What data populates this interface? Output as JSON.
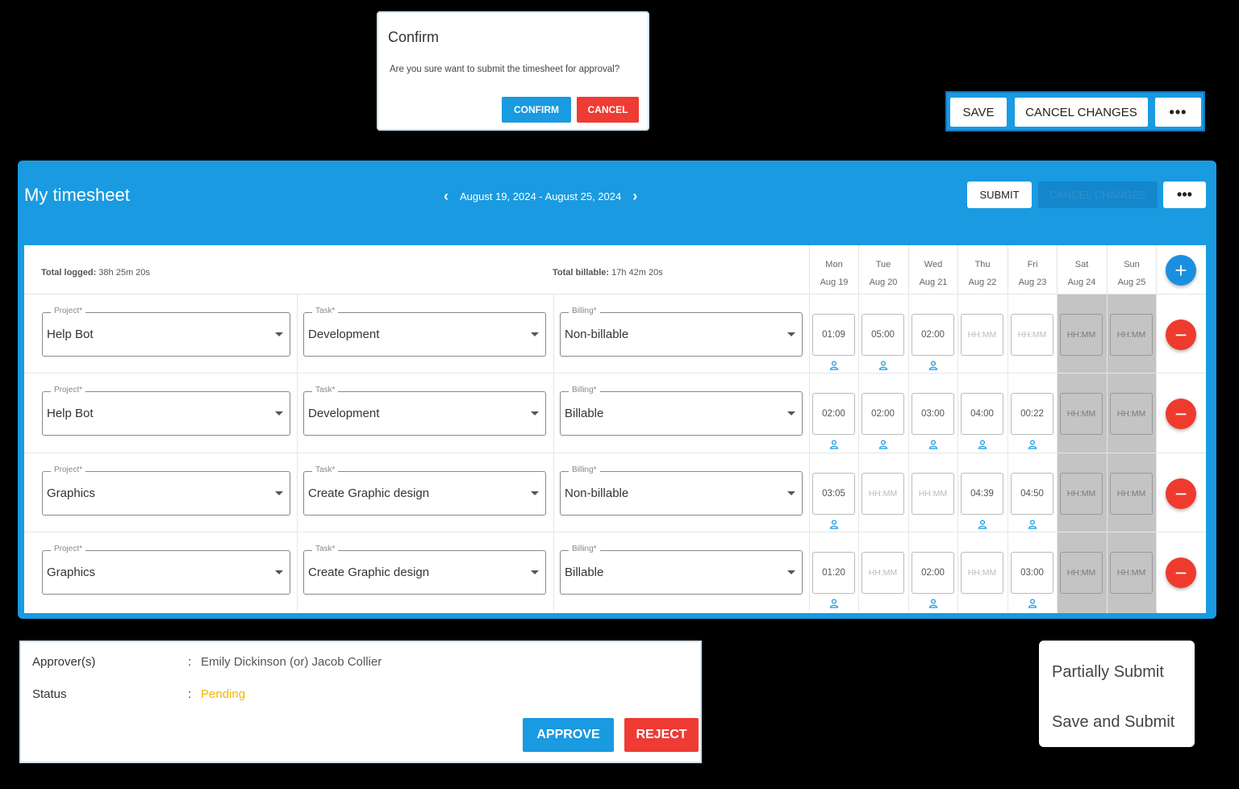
{
  "confirm": {
    "title": "Confirm",
    "message": "Are you sure want to submit the timesheet for approval?",
    "confirm_label": "CONFIRM",
    "cancel_label": "CANCEL"
  },
  "toolbar": {
    "save_label": "SAVE",
    "cancel_changes_label": "CANCEL CHANGES",
    "more_label": "•••"
  },
  "timesheet": {
    "title": "My timesheet",
    "prev_icon": "‹",
    "next_icon": "›",
    "date_range": "August 19, 2024 - August 25, 2024",
    "submit_label": "SUBMIT",
    "cancel_changes_label": "CANCEL CHANGES",
    "more_label": "•••",
    "total_logged_label": "Total logged:",
    "total_logged": "38h 25m 20s",
    "total_billable_label": "Total billable:",
    "total_billable": "17h 42m 20s",
    "add_icon": "+",
    "remove_icon": "−",
    "days": [
      {
        "day": "Mon",
        "date": "Aug 19"
      },
      {
        "day": "Tue",
        "date": "Aug 20"
      },
      {
        "day": "Wed",
        "date": "Aug 21"
      },
      {
        "day": "Thu",
        "date": "Aug 22"
      },
      {
        "day": "Fri",
        "date": "Aug 23"
      },
      {
        "day": "Sat",
        "date": "Aug 24"
      },
      {
        "day": "Sun",
        "date": "Aug 25"
      }
    ],
    "field_labels": {
      "project": "Project*",
      "task": "Task*",
      "billing": "Billing*"
    },
    "rows": [
      {
        "project": "Help Bot",
        "task": "Development",
        "billing": "Non-billable",
        "times": [
          "01:09",
          "05:00",
          "02:00",
          "HH:MM",
          "HH:MM",
          "HH:MM",
          "HH:MM"
        ]
      },
      {
        "project": "Help Bot",
        "task": "Development",
        "billing": "Billable",
        "times": [
          "02:00",
          "02:00",
          "03:00",
          "04:00",
          "00:22",
          "HH:MM",
          "HH:MM"
        ]
      },
      {
        "project": "Graphics",
        "task": "Create Graphic design",
        "billing": "Non-billable",
        "times": [
          "03:05",
          "HH:MM",
          "HH:MM",
          "04:39",
          "04:50",
          "HH:MM",
          "HH:MM"
        ]
      },
      {
        "project": "Graphics",
        "task": "Create Graphic design",
        "billing": "Billable",
        "times": [
          "01:20",
          "HH:MM",
          "02:00",
          "HH:MM",
          "03:00",
          "HH:MM",
          "HH:MM"
        ]
      }
    ]
  },
  "approval": {
    "approvers_label": "Approver(s)",
    "approvers_value": "Emily Dickinson (or) Jacob Collier",
    "status_label": "Status",
    "status_value": "Pending",
    "status_color": "#f2b600",
    "colon": ":",
    "approve_label": "APPROVE",
    "reject_label": "REJECT"
  },
  "submit_menu": {
    "partially_submit": "Partially Submit",
    "save_and_submit": "Save and Submit"
  },
  "colors": {
    "accent": "#1a9ae0",
    "danger": "#ee3b34",
    "weekend": "#c4c4c4"
  }
}
